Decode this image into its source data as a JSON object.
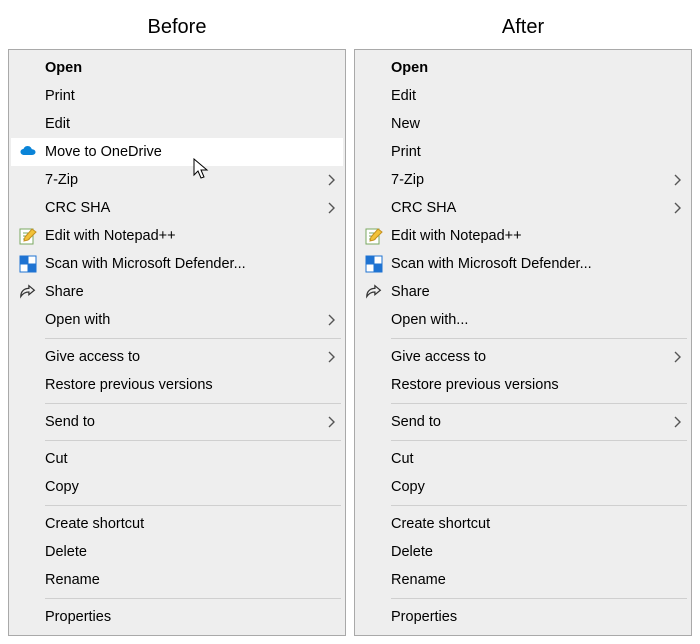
{
  "headings": {
    "before": "Before",
    "after": "After"
  },
  "icons": {
    "onedrive": "onedrive",
    "notepadpp": "notepadpp",
    "defender": "defender",
    "share": "share"
  },
  "before": {
    "items": [
      {
        "id": "open",
        "label": "Open",
        "bold": true
      },
      {
        "id": "print",
        "label": "Print"
      },
      {
        "id": "edit",
        "label": "Edit"
      },
      {
        "id": "move-onedrive",
        "label": "Move to OneDrive",
        "icon": "onedrive",
        "hover": true,
        "cursor": true
      },
      {
        "id": "7zip",
        "label": "7-Zip",
        "submenu": true
      },
      {
        "id": "crc-sha",
        "label": "CRC SHA",
        "submenu": true
      },
      {
        "id": "npp",
        "label": "Edit with Notepad++",
        "icon": "notepadpp"
      },
      {
        "id": "defender",
        "label": "Scan with Microsoft Defender...",
        "icon": "defender"
      },
      {
        "id": "share",
        "label": "Share",
        "icon": "share"
      },
      {
        "id": "open-with",
        "label": "Open with",
        "submenu": true
      },
      {
        "sep": true
      },
      {
        "id": "give-access",
        "label": "Give access to",
        "submenu": true
      },
      {
        "id": "restore",
        "label": "Restore previous versions"
      },
      {
        "sep": true
      },
      {
        "id": "send-to",
        "label": "Send to",
        "submenu": true
      },
      {
        "sep": true
      },
      {
        "id": "cut",
        "label": "Cut"
      },
      {
        "id": "copy",
        "label": "Copy"
      },
      {
        "sep": true
      },
      {
        "id": "shortcut",
        "label": "Create shortcut"
      },
      {
        "id": "delete",
        "label": "Delete"
      },
      {
        "id": "rename",
        "label": "Rename"
      },
      {
        "sep": true
      },
      {
        "id": "props",
        "label": "Properties"
      }
    ]
  },
  "after": {
    "items": [
      {
        "id": "open",
        "label": "Open",
        "bold": true
      },
      {
        "id": "edit",
        "label": "Edit"
      },
      {
        "id": "new",
        "label": "New"
      },
      {
        "id": "print",
        "label": "Print"
      },
      {
        "id": "7zip",
        "label": "7-Zip",
        "submenu": true
      },
      {
        "id": "crc-sha",
        "label": "CRC SHA",
        "submenu": true
      },
      {
        "id": "npp",
        "label": "Edit with Notepad++",
        "icon": "notepadpp"
      },
      {
        "id": "defender",
        "label": "Scan with Microsoft Defender...",
        "icon": "defender"
      },
      {
        "id": "share",
        "label": "Share",
        "icon": "share"
      },
      {
        "id": "open-with",
        "label": "Open with..."
      },
      {
        "sep": true
      },
      {
        "id": "give-access",
        "label": "Give access to",
        "submenu": true
      },
      {
        "id": "restore",
        "label": "Restore previous versions"
      },
      {
        "sep": true
      },
      {
        "id": "send-to",
        "label": "Send to",
        "submenu": true
      },
      {
        "sep": true
      },
      {
        "id": "cut",
        "label": "Cut"
      },
      {
        "id": "copy",
        "label": "Copy"
      },
      {
        "sep": true
      },
      {
        "id": "shortcut",
        "label": "Create shortcut"
      },
      {
        "id": "delete",
        "label": "Delete"
      },
      {
        "id": "rename",
        "label": "Rename"
      },
      {
        "sep": true
      },
      {
        "id": "props",
        "label": "Properties"
      }
    ]
  }
}
